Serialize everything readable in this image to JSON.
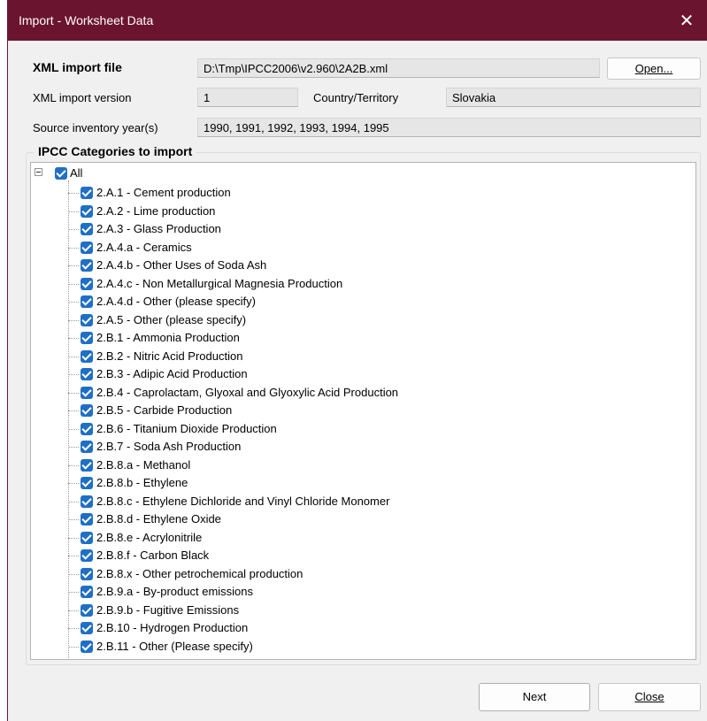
{
  "window": {
    "title": "Import - Worksheet Data",
    "close_glyph": "✕",
    "accent_color": "#6b1430"
  },
  "form": {
    "xml_file_label": "XML import file",
    "xml_file_value": "D:\\Tmp\\IPCC2006\\v2.960\\2A2B.xml",
    "open_button": "Open...",
    "version_label": "XML import version",
    "version_value": "1",
    "country_label": "Country/Territory",
    "country_value": "Slovakia",
    "years_label": "Source inventory year(s)",
    "years_value": "1990, 1991, 1992, 1993, 1994, 1995"
  },
  "categories": {
    "group_title": "IPCC Categories to import",
    "root_label": "All",
    "items": [
      "2.A.1 - Cement production",
      "2.A.2 - Lime production",
      "2.A.3 - Glass Production",
      "2.A.4.a - Ceramics",
      "2.A.4.b - Other Uses of Soda Ash",
      "2.A.4.c - Non Metallurgical Magnesia Production",
      "2.A.4.d - Other (please specify)",
      "2.A.5 - Other (please specify)",
      "2.B.1 - Ammonia Production",
      "2.B.2 - Nitric Acid Production",
      "2.B.3 - Adipic Acid Production",
      "2.B.4 - Caprolactam, Glyoxal and Glyoxylic Acid Production",
      "2.B.5 - Carbide Production",
      "2.B.6 - Titanium Dioxide Production",
      "2.B.7 - Soda Ash Production",
      "2.B.8.a - Methanol",
      "2.B.8.b - Ethylene",
      "2.B.8.c - Ethylene Dichloride and Vinyl Chloride Monomer",
      "2.B.8.d - Ethylene Oxide",
      "2.B.8.e - Acrylonitrile",
      "2.B.8.f - Carbon Black",
      "2.B.8.x - Other petrochemical production",
      "2.B.9.a - By-product emissions",
      "2.B.9.b - Fugitive Emissions",
      "2.B.10 - Hydrogen Production",
      "2.B.11 - Other (Please specify)"
    ]
  },
  "footer": {
    "next_button": "Next",
    "close_button": "Close"
  }
}
